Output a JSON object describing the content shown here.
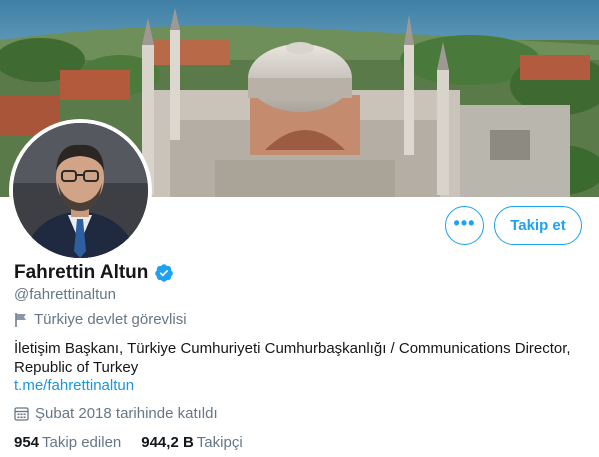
{
  "profile": {
    "display_name": "Fahrettin Altun",
    "handle": "@fahrettinaltun",
    "verified": true,
    "account_label": "Türkiye devlet görevlisi",
    "bio": "İletişim Başkanı, Türkiye Cumhuriyeti Cumhurbaşkanlığı / Communications Director, Republic of Turkey",
    "link": "t.me/fahrettinaltun",
    "joined": "Şubat 2018 tarihinde katıldı"
  },
  "actions": {
    "more_label": "•••",
    "follow_label": "Takip et"
  },
  "stats": {
    "following_count": "954",
    "following_label": "Takip edilen",
    "followers_count": "944,2 B",
    "followers_label": "Takipçi"
  },
  "icons": {
    "more": "more-dots-icon",
    "verified": "verified-badge-icon",
    "label": "flag-icon",
    "joined": "calendar-icon"
  },
  "colors": {
    "accent": "#1da1f2",
    "link": "#1b95e0",
    "secondary_text": "#657786",
    "primary_text": "#14171a"
  }
}
